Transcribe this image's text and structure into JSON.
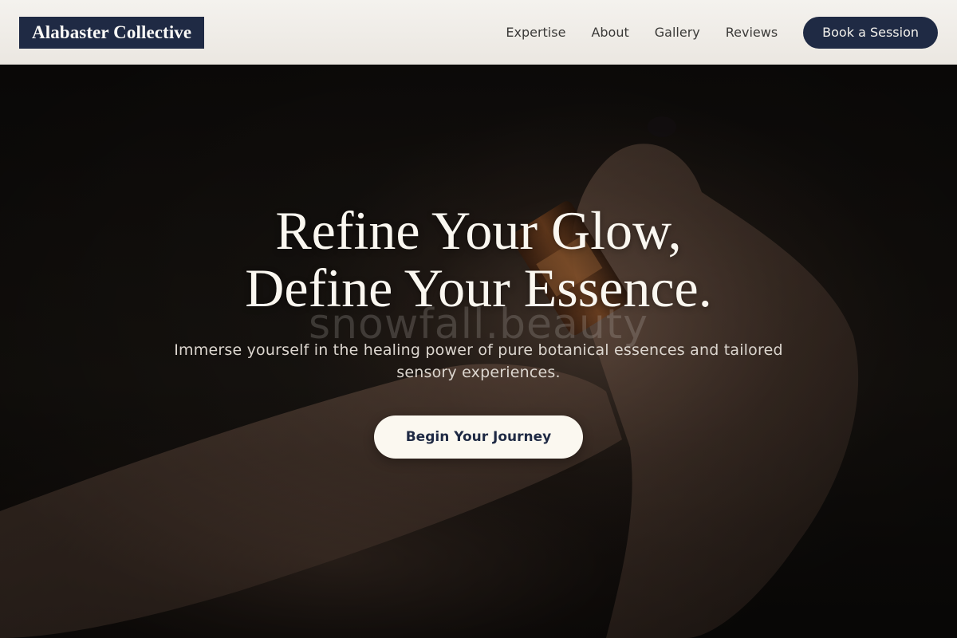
{
  "header": {
    "logo": "Alabaster Collective",
    "nav": [
      "Expertise",
      "About",
      "Gallery",
      "Reviews"
    ],
    "book_label": "Book a Session"
  },
  "hero": {
    "title_line1": "Refine Your Glow,",
    "title_line2": "Define Your Essence.",
    "watermark": "snowfall.beauty",
    "subtitle": "Immerse yourself in the healing power of pure botanical essences and tailored sensory experiences.",
    "cta_label": "Begin Your Journey"
  },
  "colors": {
    "brand_navy": "#1f2a44",
    "cream": "#fbf8f0",
    "header_bg": "#f0ede8"
  }
}
